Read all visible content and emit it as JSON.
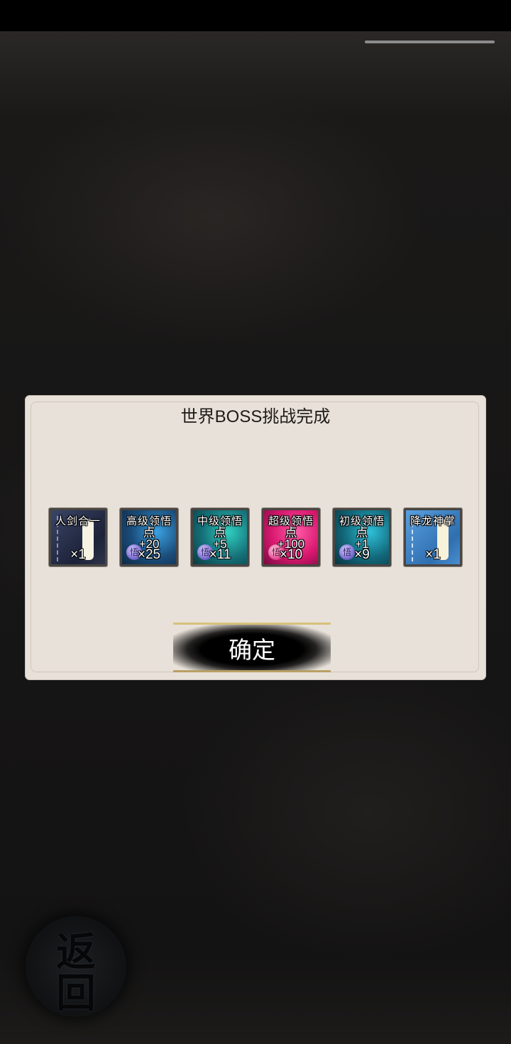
{
  "dialog": {
    "title": "世界BOSS挑战完成",
    "confirm_label": "确定"
  },
  "rewards": [
    {
      "name": "人剑合一",
      "bonus": "",
      "count": "×1",
      "icon": "sword-manual-book-icon",
      "color": "#2a3250"
    },
    {
      "name": "高级领悟",
      "bonus": "点\n+20",
      "count": "×25",
      "icon": "comprehension-point-icon",
      "color": "#1e5e8a"
    },
    {
      "name": "中级领悟",
      "bonus": "点\n+5",
      "count": "×11",
      "icon": "comprehension-point-icon",
      "color": "#167a84"
    },
    {
      "name": "超级领悟",
      "bonus": "点\n+100",
      "count": "×10",
      "icon": "comprehension-point-icon",
      "color": "#d2156e"
    },
    {
      "name": "初级领悟",
      "bonus": "点\n+1",
      "count": "×9",
      "icon": "comprehension-point-icon",
      "color": "#1f7d8e"
    },
    {
      "name": "降龙神掌",
      "bonus": "",
      "count": "×1",
      "icon": "palm-manual-book-icon",
      "color": "#3c7fc1"
    }
  ],
  "back_button": {
    "label_top": "返",
    "label_bottom": "回"
  }
}
